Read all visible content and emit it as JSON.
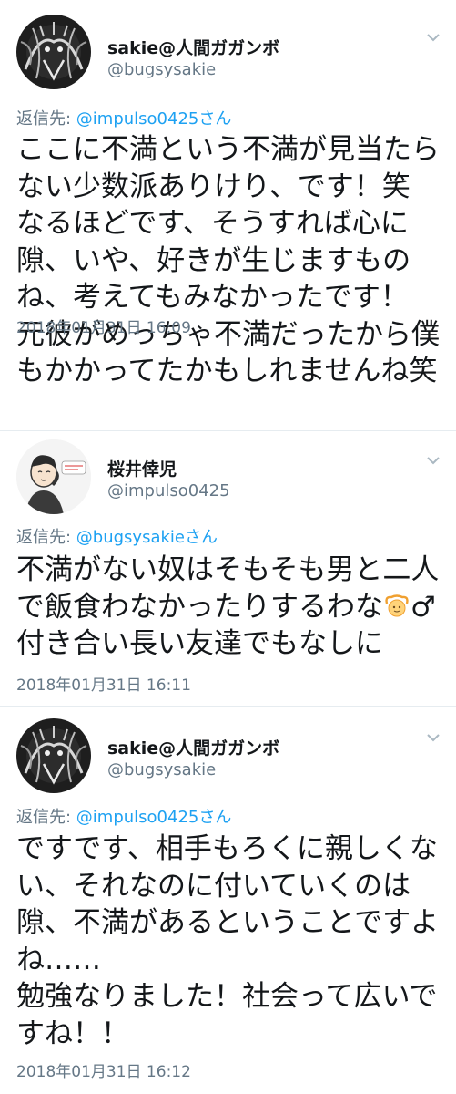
{
  "reply_prefix": "返信先: ",
  "tweets": [
    {
      "display_name": "sakie@人間ガガンボ",
      "handle": "@bugsysakie",
      "reply_to": "@impulso0425さん",
      "lines": [
        "ここに不満という不満が見当たら",
        "ない少数派ありけり、です！笑",
        "なるほどです、そうすれば心に",
        "隙、いや、好きが生じますもの",
        "ね、考えてもみなかったです！",
        "元彼がめっちゃ不満だったから僕",
        "もかかってたかもしれませんね笑"
      ],
      "timestamp": "2018年01月31日 16:09"
    },
    {
      "display_name": "桜井倖児",
      "handle": "@impulso0425",
      "reply_to": "@bugsysakieさん",
      "lines": [
        "不満がない奴はそもそも男と二人",
        "で飯食わなかったりするわな",
        "付き合い長い友達でもなしに"
      ],
      "emoji_suffix": "♂",
      "timestamp": "2018年01月31日 16:11"
    },
    {
      "display_name": "sakie@人間ガガンボ",
      "handle": "@bugsysakie",
      "reply_to": "@impulso0425さん",
      "lines": [
        "ですです、相手もろくに親しくな",
        "い、それなのに付いていくのは",
        "隙、不満があるということですよ",
        "ね……",
        "勉強なりました！社会って広いで",
        "すね！！"
      ],
      "timestamp": "2018年01月31日 16:12"
    }
  ],
  "icons": {
    "avatar_1": "dark-illustration-avatar",
    "avatar_2": "person-leaning-avatar",
    "chevron": "chevron-down-icon",
    "emoji": "person-gesturing-ok-emoji"
  },
  "colors": {
    "link": "#1da1f2",
    "secondary": "#657786",
    "text": "#14171a"
  }
}
